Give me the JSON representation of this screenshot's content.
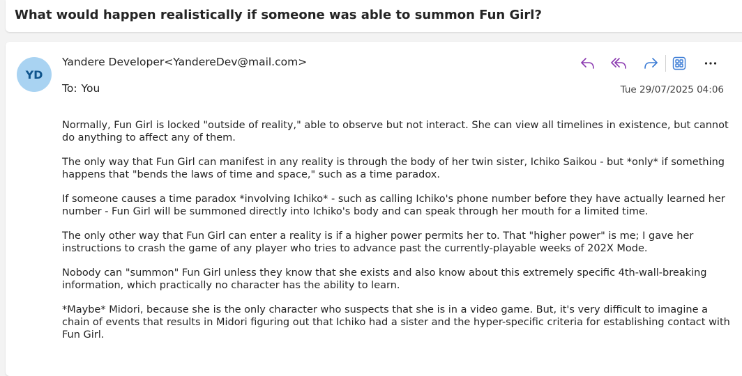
{
  "subject": "What would happen realistically if someone was able to summon Fun Girl?",
  "avatar": {
    "initials": "YD",
    "color": "#a9d3f2"
  },
  "sender": "Yandere Developer<YandereDev@mail.com>",
  "to": {
    "label": "To:",
    "value": "You"
  },
  "timestamp": "Tue 29/07/2025 04:06",
  "actions": [
    {
      "icon": "reply-icon",
      "color": "#8b3ab0"
    },
    {
      "icon": "reply-all-icon",
      "color": "#8b3ab0"
    },
    {
      "icon": "forward-icon",
      "color": "#3a7bd5"
    },
    {
      "icon": "apps-icon",
      "color": "#3a7bd5"
    },
    {
      "icon": "more-icon",
      "color": "#242424"
    }
  ],
  "body": [
    "Normally, Fun Girl is locked \"outside of reality,\" able to observe but not interact. She can view all timelines in existence, but cannot do anything to affect any of them.",
    "The only way that Fun Girl can manifest in any reality is through the body of her twin sister, Ichiko Saikou - but *only* if something happens that \"bends the laws of time and space,\" such as a time paradox.",
    "If someone causes a time paradox *involving Ichiko* - such as calling Ichiko's phone number before they have actually learned her number - Fun Girl will be summoned directly into Ichiko's body and can speak through her mouth for a limited time.",
    "The only other way that Fun Girl can enter a reality is if a higher power permits her to. That \"higher power\" is me; I gave her instructions to crash the game of any player who tries to advance past the currently-playable weeks of 202X Mode.",
    "Nobody can \"summon\" Fun Girl unless they know that she exists and also know about this extremely specific 4th-wall-breaking information, which practically no character has the ability to learn.",
    "*Maybe* Midori, because she is the only character who suspects that she is in a video game. But, it's very difficult to imagine a chain of events that results in Midori figuring out that Ichiko had a sister and the hyper-specific criteria for establishing contact with Fun Girl."
  ]
}
